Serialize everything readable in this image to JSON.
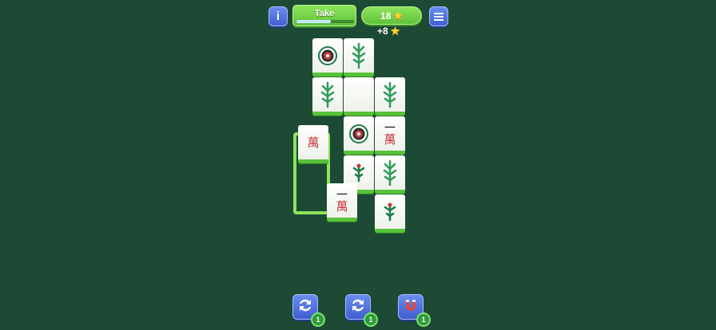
{
  "header": {
    "info_label": "i",
    "take_label": "Take",
    "take_progress": 0.6,
    "score": "18",
    "bonus": "+8"
  },
  "tiles": [
    {
      "suit": "circle"
    },
    {
      "suit": "bamboo"
    },
    {
      "suit": "bamboo"
    },
    {
      "suit": "blank"
    },
    {
      "suit": "bamboo"
    },
    {
      "suit": "character",
      "top": "",
      "bottom": "萬"
    },
    {
      "suit": "circle"
    },
    {
      "suit": "character",
      "top": "一",
      "bottom": "萬"
    },
    {
      "suit": "bamboo-bird"
    },
    {
      "suit": "bamboo"
    },
    {
      "suit": "character",
      "top": "一",
      "bottom": "萬"
    },
    {
      "suit": "bamboo-bird"
    }
  ],
  "boosters": [
    {
      "icon": "shuffle-icon",
      "count": "1"
    },
    {
      "icon": "shuffle-icon",
      "count": "1"
    },
    {
      "icon": "magnet-icon",
      "count": "1"
    }
  ],
  "colors": {
    "background": "#1c4a35",
    "accent_green": "#5fc23a",
    "button_blue": "#3f5fd0",
    "tile_face": "#ffffff"
  }
}
